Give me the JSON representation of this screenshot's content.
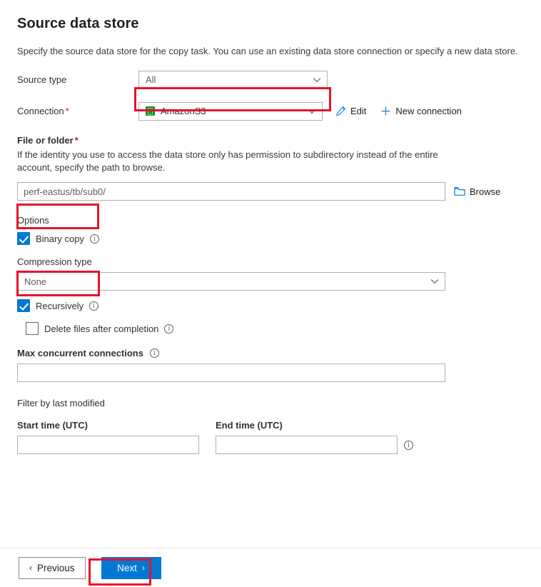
{
  "page": {
    "title": "Source data store",
    "description": "Specify the source data store for the copy task. You can use an existing data store connection or specify a new data store."
  },
  "source_type": {
    "label": "Source type",
    "value": "All",
    "chevron_icon": "chevron-down-icon"
  },
  "connection": {
    "label": "Connection",
    "required_marker": "*",
    "value": "AmazonS3",
    "icon": "amazon-s3-icon",
    "chevron_icon": "chevron-down-icon",
    "edit_label": "Edit",
    "edit_icon": "pencil-icon",
    "new_connection_label": "New connection",
    "new_connection_icon": "plus-icon"
  },
  "file_or_folder": {
    "label": "File or folder",
    "required_marker": "*",
    "helper": "If the identity you use to access the data store only has permission to subdirectory instead of the entire account, specify the path to browse.",
    "value": "perf-eastus/tb/sub0/",
    "placeholder": "perf-eastus/tb/sub0/",
    "browse_label": "Browse",
    "browse_icon": "folder-icon"
  },
  "options": {
    "label": "Options",
    "binary_copy": {
      "label": "Binary copy",
      "checked": true,
      "info_icon": "info-icon"
    },
    "compression_type": {
      "label": "Compression type",
      "value": "None",
      "chevron_icon": "chevron-down-icon"
    },
    "recursively": {
      "label": "Recursively",
      "checked": true,
      "info_icon": "info-icon"
    },
    "delete_files": {
      "label": "Delete files after completion",
      "checked": false,
      "info_icon": "info-icon"
    },
    "max_concurrent_connections": {
      "label": "Max concurrent connections",
      "value": "",
      "info_icon": "info-icon"
    }
  },
  "filter": {
    "section_label": "Filter by last modified",
    "start_time_label": "Start time (UTC)",
    "start_time_value": "",
    "end_time_label": "End time (UTC)",
    "end_time_value": "",
    "info_icon": "info-icon"
  },
  "footer": {
    "previous_label": "Previous",
    "previous_chevron": "‹",
    "next_label": "Next",
    "next_chevron": "›"
  },
  "highlights": {
    "color": "#e8112d",
    "targets": [
      "connection-dropdown",
      "binary-copy-checkbox",
      "recursively-checkbox",
      "next-button"
    ]
  },
  "theme": {
    "accent": "#0078d4",
    "required_star": "#a4262c",
    "text": "#323130",
    "border": "#b3b0ad"
  }
}
